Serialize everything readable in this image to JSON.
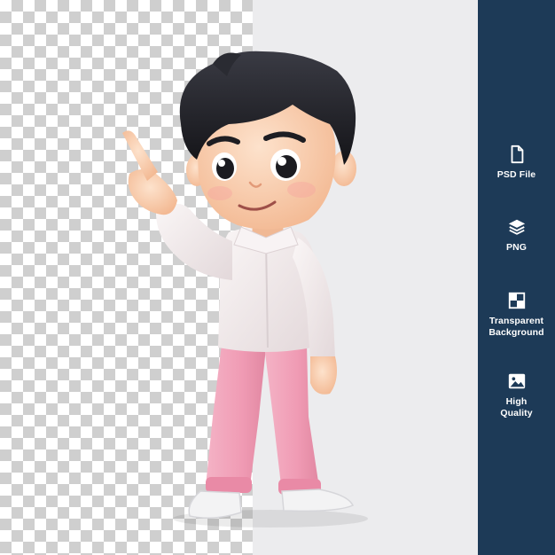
{
  "colors": {
    "sidebar_bg": "#1d3a57",
    "checker_dark": "#cfcfcf",
    "checker_light": "#ffffff",
    "panel_bg": "#ececee",
    "shirt": "#f4eeef",
    "pants": "#f2a9bf",
    "hair": "#1f1f24",
    "skin": "#fbd3b6"
  },
  "features": [
    {
      "icon": "file-icon",
      "label_line1": "PSD File",
      "label_line2": ""
    },
    {
      "icon": "layers-icon",
      "label_line1": "PNG",
      "label_line2": ""
    },
    {
      "icon": "transparency-grid-icon",
      "label_line1": "Transparent",
      "label_line2": "Background"
    },
    {
      "icon": "image-icon",
      "label_line1": "High",
      "label_line2": "Quality"
    }
  ]
}
